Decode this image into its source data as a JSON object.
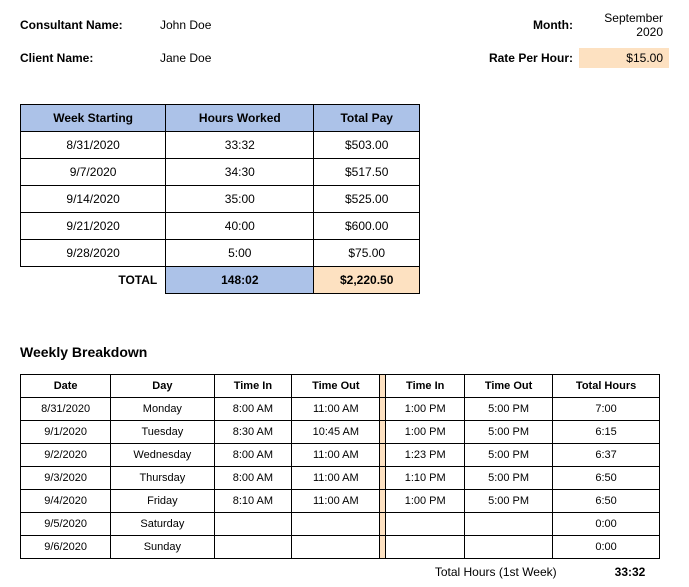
{
  "header": {
    "consultant_label": "Consultant Name:",
    "consultant_value": "John Doe",
    "client_label": "Client Name:",
    "client_value": "Jane Doe",
    "month_label": "Month:",
    "month_value": "September 2020",
    "rate_label": "Rate Per Hour:",
    "rate_value": "$15.00"
  },
  "summary": {
    "headers": {
      "week": "Week Starting",
      "hours": "Hours Worked",
      "pay": "Total Pay"
    },
    "rows": [
      {
        "week": "8/31/2020",
        "hours": "33:32",
        "pay": "$503.00"
      },
      {
        "week": "9/7/2020",
        "hours": "34:30",
        "pay": "$517.50"
      },
      {
        "week": "9/14/2020",
        "hours": "35:00",
        "pay": "$525.00"
      },
      {
        "week": "9/21/2020",
        "hours": "40:00",
        "pay": "$600.00"
      },
      {
        "week": "9/28/2020",
        "hours": "5:00",
        "pay": "$75.00"
      }
    ],
    "total_label": "TOTAL",
    "total_hours": "148:02",
    "total_pay": "$2,220.50"
  },
  "breakdown": {
    "title": "Weekly Breakdown",
    "headers": {
      "date": "Date",
      "day": "Day",
      "time_in_1": "Time In",
      "time_out_1": "Time Out",
      "time_in_2": "Time In",
      "time_out_2": "Time Out",
      "total_hours": "Total Hours"
    },
    "rows": [
      {
        "date": "8/31/2020",
        "day": "Monday",
        "in1": "8:00 AM",
        "out1": "11:00 AM",
        "in2": "1:00 PM",
        "out2": "5:00 PM",
        "total": "7:00"
      },
      {
        "date": "9/1/2020",
        "day": "Tuesday",
        "in1": "8:30 AM",
        "out1": "10:45 AM",
        "in2": "1:00 PM",
        "out2": "5:00 PM",
        "total": "6:15"
      },
      {
        "date": "9/2/2020",
        "day": "Wednesday",
        "in1": "8:00 AM",
        "out1": "11:00 AM",
        "in2": "1:23 PM",
        "out2": "5:00 PM",
        "total": "6:37"
      },
      {
        "date": "9/3/2020",
        "day": "Thursday",
        "in1": "8:00 AM",
        "out1": "11:00 AM",
        "in2": "1:10 PM",
        "out2": "5:00 PM",
        "total": "6:50"
      },
      {
        "date": "9/4/2020",
        "day": "Friday",
        "in1": "8:10 AM",
        "out1": "11:00 AM",
        "in2": "1:00 PM",
        "out2": "5:00 PM",
        "total": "6:50"
      },
      {
        "date": "9/5/2020",
        "day": "Saturday",
        "in1": "",
        "out1": "",
        "in2": "",
        "out2": "",
        "total": "0:00"
      },
      {
        "date": "9/6/2020",
        "day": "Sunday",
        "in1": "",
        "out1": "",
        "in2": "",
        "out2": "",
        "total": "0:00"
      }
    ],
    "total_label": "Total Hours (1st Week)",
    "total_value": "33:32"
  }
}
